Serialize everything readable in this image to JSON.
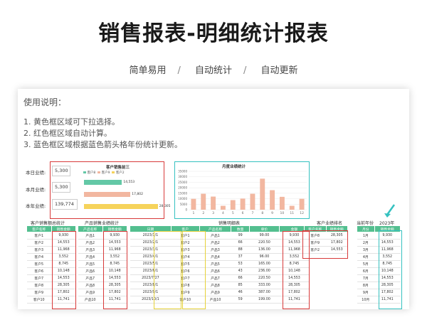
{
  "header": {
    "title": "销售报表-明细统计报表"
  },
  "subnav": {
    "items": [
      "简单易用",
      "自动统计",
      "自动更新"
    ],
    "sep": "/"
  },
  "instructions": {
    "title": "使用说明：",
    "lines": [
      "1. 黄色框区域可下拉选择。",
      "2. 红色框区域自动计算。",
      "3. 蓝色框区域根据蓝色箭头格年份统计更新。"
    ]
  },
  "summary": {
    "labels": [
      "本日业绩:",
      "本月业绩:",
      "本年业绩:"
    ],
    "values": [
      "5,300",
      "5,300",
      "139,774"
    ]
  },
  "top3_chart": {
    "title": "客户销售前三",
    "legend": [
      "客户8",
      "客户9",
      "客户2"
    ],
    "values": [
      14553,
      17802,
      28305
    ],
    "labels": [
      "14,553",
      "17,802",
      "28,305"
    ],
    "colors": [
      "#63c8a6",
      "#f2b7a0",
      "#f6d35b"
    ]
  },
  "monthly_chart": {
    "title": "月度业绩统计",
    "months": [
      "1",
      "2",
      "3",
      "4",
      "5",
      "6",
      "7",
      "8",
      "9",
      "10",
      "11",
      "12"
    ],
    "values": [
      9930,
      14553,
      11968,
      3552,
      8745,
      10148,
      14553,
      28305,
      17802,
      11741,
      3552,
      9930
    ],
    "yticks": [
      "0",
      "5000",
      "10000",
      "15000",
      "20000",
      "25000",
      "30000",
      "35000"
    ],
    "ymax": 35000,
    "color": "#f2b7a0"
  },
  "customer_table": {
    "section": "客户销售额总统计",
    "headers": [
      "客户名称",
      "销售金额"
    ],
    "rows": [
      [
        "客户1",
        "9,930"
      ],
      [
        "客户2",
        "14,553"
      ],
      [
        "客户3",
        "11,968"
      ],
      [
        "客户4",
        "3,552"
      ],
      [
        "客户5",
        "8,745"
      ],
      [
        "客户6",
        "10,148"
      ],
      [
        "客户7",
        "14,553"
      ],
      [
        "客户8",
        "28,305"
      ],
      [
        "客户9",
        "17,802"
      ],
      [
        "客户10",
        "11,741"
      ]
    ]
  },
  "product_table": {
    "section": "产品销售业绩统计",
    "headers": [
      "产品名称",
      "销售金额"
    ],
    "rows": [
      [
        "产品1",
        "9,930"
      ],
      [
        "产品2",
        "14,553"
      ],
      [
        "产品3",
        "11,968"
      ],
      [
        "产品4",
        "3,552"
      ],
      [
        "产品5",
        "8,745"
      ],
      [
        "产品6",
        "10,148"
      ],
      [
        "产品7",
        "14,553"
      ],
      [
        "产品8",
        "28,305"
      ],
      [
        "产品9",
        "17,802"
      ],
      [
        "产品10",
        "11,741"
      ]
    ]
  },
  "detail_table": {
    "section": "销售明细表",
    "headers": [
      "日期",
      "客户",
      "产品名称",
      "数量",
      "单价",
      "金额"
    ],
    "rows": [
      [
        "2023/1/1",
        "客户1",
        "产品1",
        "99",
        "99.00",
        "9,930"
      ],
      [
        "2023/2/1",
        "客户2",
        "产品2",
        "66",
        "220.50",
        "14,553"
      ],
      [
        "2023/3/1",
        "客户3",
        "产品3",
        "88",
        "136.00",
        "11,968"
      ],
      [
        "2023/4/1",
        "客户4",
        "产品4",
        "37",
        "96.00",
        "3,552"
      ],
      [
        "2023/5/1",
        "客户5",
        "产品5",
        "53",
        "165.00",
        "8,745"
      ],
      [
        "2023/6/1",
        "客户6",
        "产品6",
        "43",
        "236.00",
        "10,148"
      ],
      [
        "2023/7/27",
        "客户7",
        "产品7",
        "66",
        "220.50",
        "14,553"
      ],
      [
        "2023/8/1",
        "客户8",
        "产品8",
        "85",
        "333.00",
        "28,305"
      ],
      [
        "2023/9/1",
        "客户9",
        "产品9",
        "46",
        "387.00",
        "17,802"
      ],
      [
        "2023/10/1",
        "客户10",
        "产品10",
        "59",
        "199.00",
        "11,741"
      ]
    ]
  },
  "rank_table": {
    "section": "客户业绩排名",
    "headers": [
      "客户名称",
      "销售金额"
    ],
    "rows": [
      [
        "客户8",
        "28,305"
      ],
      [
        "客户9",
        "17,802"
      ],
      [
        "客户2",
        "14,553"
      ]
    ]
  },
  "year_table": {
    "label": "当前年份",
    "year": "2023年",
    "headers": [
      "月份",
      "销售金额"
    ],
    "rows": [
      [
        "1月",
        "9,930"
      ],
      [
        "2月",
        "14,553"
      ],
      [
        "3月",
        "11,968"
      ],
      [
        "4月",
        "3,552"
      ],
      [
        "5月",
        "8,745"
      ],
      [
        "6月",
        "10,148"
      ],
      [
        "7月",
        "14,553"
      ],
      [
        "8月",
        "28,305"
      ],
      [
        "9月",
        "17,802"
      ],
      [
        "10月",
        "11,741"
      ]
    ]
  }
}
